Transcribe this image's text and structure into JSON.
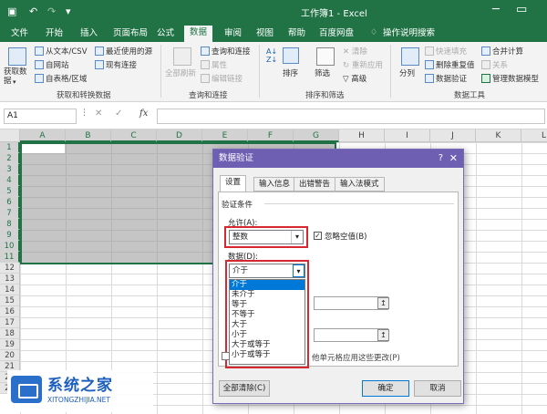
{
  "title": {
    "text": "工作簿1  -  Excel"
  },
  "tabs": [
    {
      "label": "文件"
    },
    {
      "label": "开始"
    },
    {
      "label": "插入"
    },
    {
      "label": "页面布局"
    },
    {
      "label": "公式"
    },
    {
      "label": "数据"
    },
    {
      "label": "审阅"
    },
    {
      "label": "视图"
    },
    {
      "label": "帮助"
    },
    {
      "label": "百度网盘"
    },
    {
      "label": "操作说明搜索"
    }
  ],
  "ribbon": {
    "get_data": "获取数据",
    "from_text": "从文本/CSV",
    "from_web": "自网站",
    "from_table": "自表格/区域",
    "recent_sources": "最近使用的源",
    "existing_conn": "现有连接",
    "group1": "获取和转换数据",
    "refresh_all": "全部刷新",
    "queries_conn": "查询和连接",
    "properties": "属性",
    "edit_links": "编辑链接",
    "group2": "查询和连接",
    "sort": "排序",
    "filter": "筛选",
    "clear": "清除",
    "reapply": "重新应用",
    "advanced": "高级",
    "group3": "排序和筛选",
    "split": "分列",
    "flash_fill": "快速填充",
    "remove_dup": "删除重复值",
    "data_validation": "数据验证",
    "consolidate": "合并计算",
    "relations": "关系",
    "data_model": "管理数据模型",
    "group4": "数据工具"
  },
  "formula_bar": {
    "name_box": "A1",
    "cancel": "✕",
    "enter": "✓",
    "fx": "fx"
  },
  "columns": [
    "A",
    "B",
    "C",
    "D",
    "E",
    "F",
    "G",
    "H",
    "I",
    "J",
    "K",
    "L"
  ],
  "rows": [
    "1",
    "2",
    "3",
    "4",
    "5",
    "6",
    "7",
    "8",
    "9",
    "10",
    "11",
    "12",
    "13",
    "14",
    "15",
    "16",
    "17",
    "18",
    "19",
    "20",
    "21",
    "22",
    "23"
  ],
  "dialog": {
    "title": "数据验证",
    "help": "?",
    "close": "✕",
    "tabs": [
      "设置",
      "输入信息",
      "出错警告",
      "输入法模式"
    ],
    "criteria_label": "验证条件",
    "allow_label": "允许(A):",
    "allow_value": "整数",
    "ignore_blank": "忽略空值(B)",
    "ignore_blank_checked": "✓",
    "data_label": "数据(D):",
    "data_value": "介于",
    "dropdown_items": [
      "介于",
      "未介于",
      "等于",
      "不等于",
      "大于",
      "小于",
      "大于或等于",
      "小于或等于"
    ],
    "apply_text": "他单元格应用这些更改(P)",
    "clear_all": "全部清除(C)",
    "ok": "确定",
    "cancel": "取消"
  },
  "watermark": {
    "title": "系统之家",
    "subtitle": "XITONGZHIJIA.NET"
  }
}
